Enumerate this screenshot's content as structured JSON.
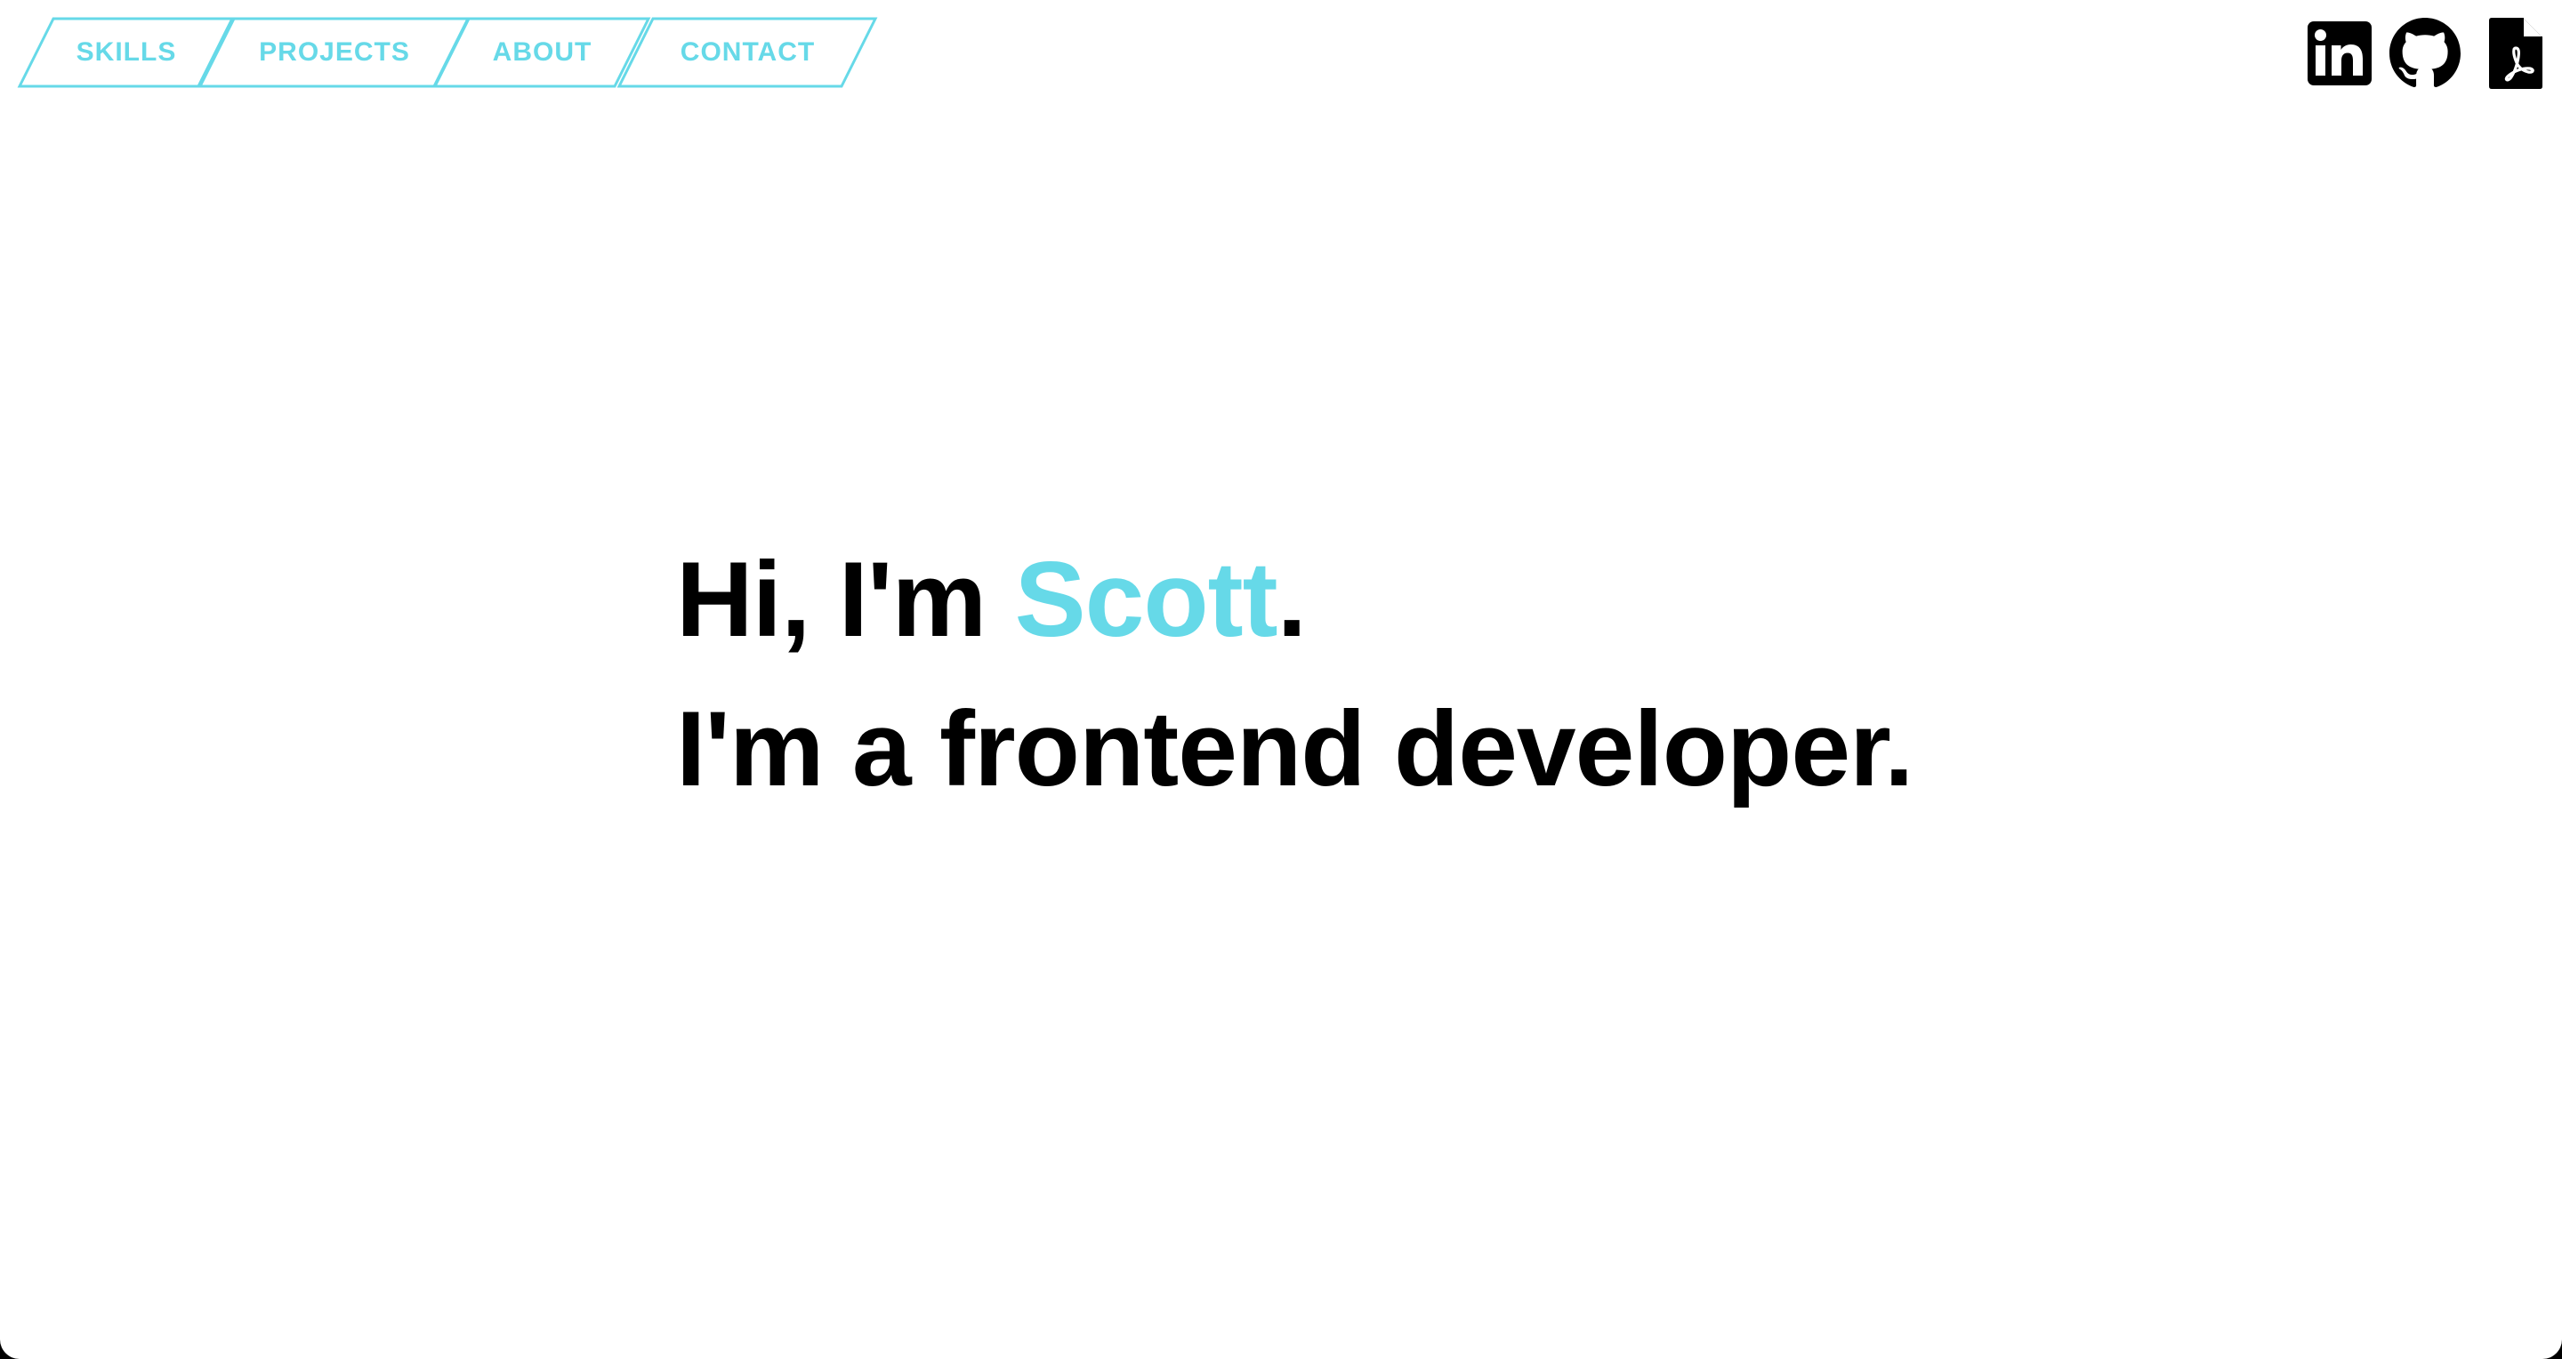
{
  "nav": {
    "items": [
      {
        "label": "SKILLS"
      },
      {
        "label": "PROJECTS"
      },
      {
        "label": "ABOUT"
      },
      {
        "label": "CONTACT"
      }
    ]
  },
  "social": {
    "icons": [
      "linkedin-icon",
      "github-icon",
      "pdf-resume-icon"
    ]
  },
  "hero": {
    "greeting_prefix": "Hi, I'm ",
    "name": "Scott",
    "greeting_suffix": ".",
    "tagline": "I'm a frontend developer."
  },
  "colors": {
    "accent": "#66d9e8",
    "text": "#000000",
    "background": "#ffffff"
  }
}
